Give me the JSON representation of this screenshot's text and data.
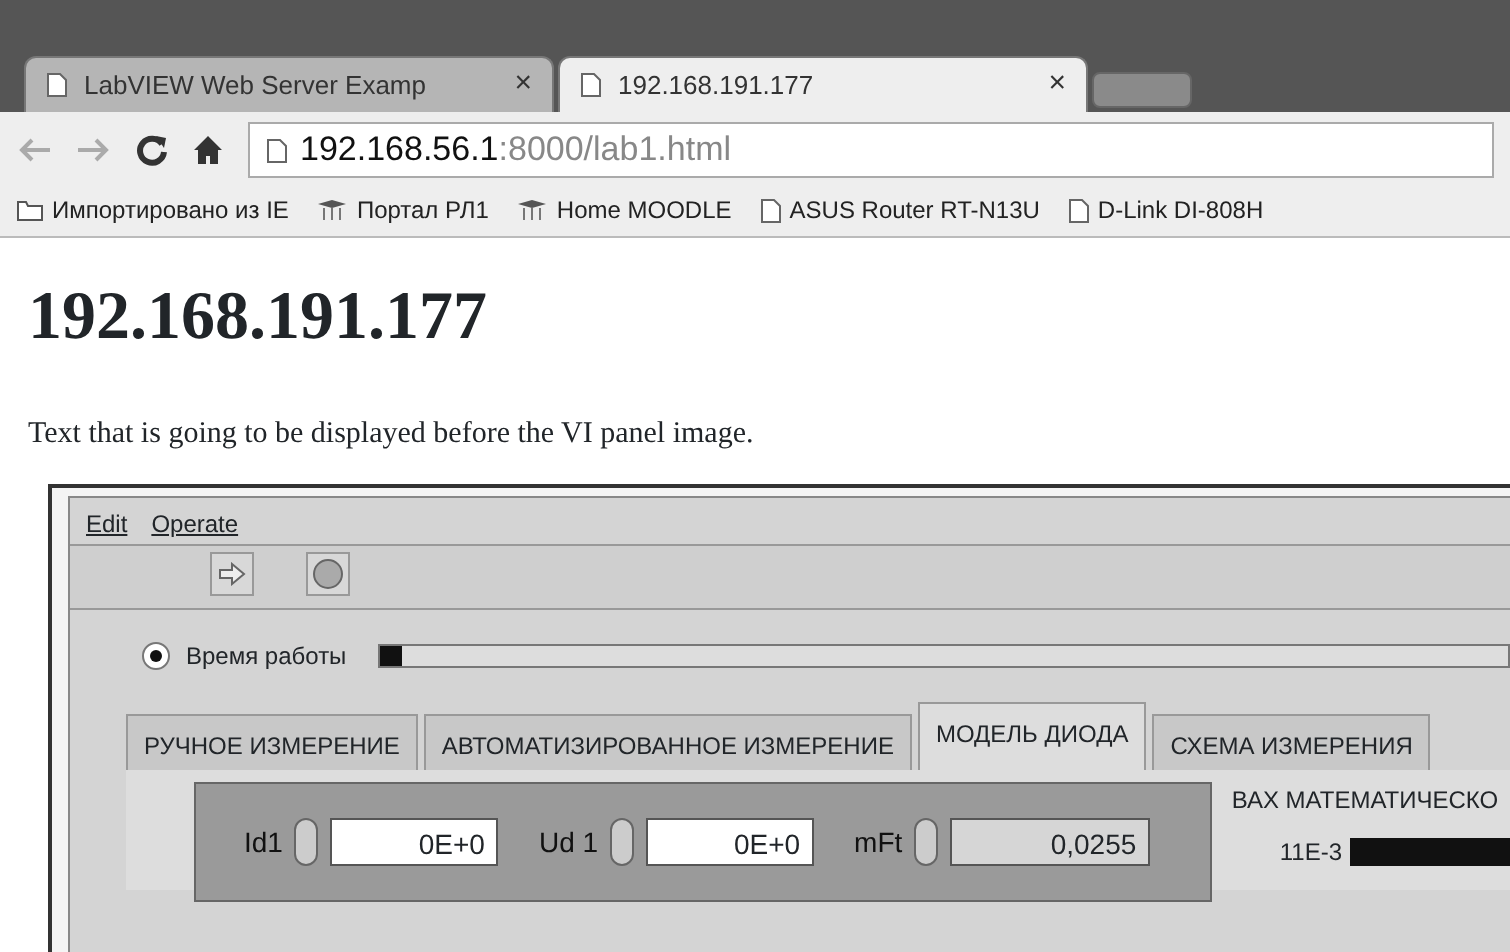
{
  "browser": {
    "tabs": [
      {
        "title": "LabVIEW Web Server Examp",
        "close": "×",
        "selected": false
      },
      {
        "title": "192.168.191.177",
        "close": "×",
        "selected": true
      }
    ],
    "address": {
      "host": "192.168.56.1",
      "rest": ":8000/lab1.html"
    },
    "bookmarks": [
      {
        "kind": "folder",
        "label": "Импортировано из IE"
      },
      {
        "kind": "cap",
        "label": "Портал РЛ1"
      },
      {
        "kind": "cap",
        "label": "Home MOODLE"
      },
      {
        "kind": "page",
        "label": "ASUS Router RT-N13U"
      },
      {
        "kind": "page",
        "label": "D-Link DI-808H"
      }
    ]
  },
  "page": {
    "heading": "192.168.191.177",
    "intro": "Text that is going to be displayed before the VI panel image."
  },
  "panel": {
    "menu": [
      "Edit",
      "Operate"
    ],
    "radio": {
      "label": "Время работы",
      "checked": true,
      "level": 0.02
    },
    "tabs": [
      {
        "label": "РУЧНОЕ  ИЗМЕРЕНИЕ",
        "selected": false
      },
      {
        "label": "АВТОМАТИЗИРОВАННОЕ ИЗМЕРЕНИЕ",
        "selected": false
      },
      {
        "label": "МОДЕЛЬ ДИОДА",
        "selected": true
      },
      {
        "label": "СХЕМА ИЗМЕРЕНИЯ",
        "selected": false
      }
    ],
    "controls": [
      {
        "label": "Id1",
        "value": "0E+0"
      },
      {
        "label": "Ud 1",
        "value": "0E+0"
      },
      {
        "label": "mFt",
        "value": "0,0255"
      }
    ],
    "graph": {
      "title": "ВАХ МАТЕМАТИЧЕСКО",
      "tick": "11E-3"
    }
  }
}
